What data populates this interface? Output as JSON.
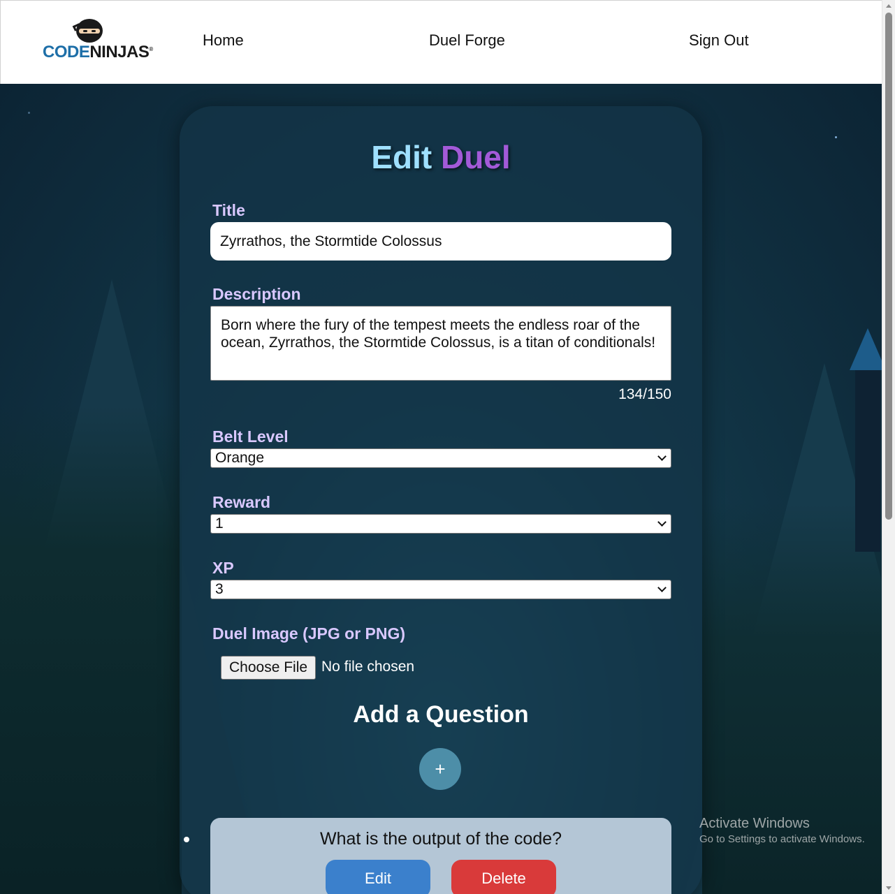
{
  "header": {
    "logo": {
      "text_part1": "CODE",
      "text_part2": "NINJAS",
      "mark": "®"
    },
    "nav": [
      {
        "label": "Home"
      },
      {
        "label": "Duel Forge"
      },
      {
        "label": "Sign Out"
      }
    ]
  },
  "form": {
    "heading_part1": "Edit",
    "heading_part2": "Duel",
    "title_label": "Title",
    "title_value": "Zyrrathos, the Stormtide Colossus",
    "description_label": "Description",
    "description_value": "Born where the fury of the tempest meets the endless roar of the ocean, Zyrrathos, the Stormtide Colossus, is a titan of conditionals!",
    "char_counter": "134/150",
    "belt_level_label": "Belt Level",
    "belt_level_value": "Orange",
    "reward_label": "Reward",
    "reward_value": "1",
    "xp_label": "XP",
    "xp_value": "3",
    "image_label": "Duel Image (JPG or PNG)",
    "choose_file_label": "Choose File",
    "file_status": "No file chosen",
    "add_question_heading": "Add a Question",
    "add_question_button": "+"
  },
  "questions": [
    {
      "text": "What is the output of the code?",
      "edit_label": "Edit",
      "delete_label": "Delete"
    }
  ],
  "watermark": {
    "line1": "Activate Windows",
    "line2": "Go to Settings to activate Windows."
  },
  "colors": {
    "heading_word1": "#9fe0ff",
    "heading_word2": "#a35ad8",
    "edit_button": "#3b80cc",
    "delete_button": "#d93a3a",
    "plus_button": "#4d8ea8"
  }
}
